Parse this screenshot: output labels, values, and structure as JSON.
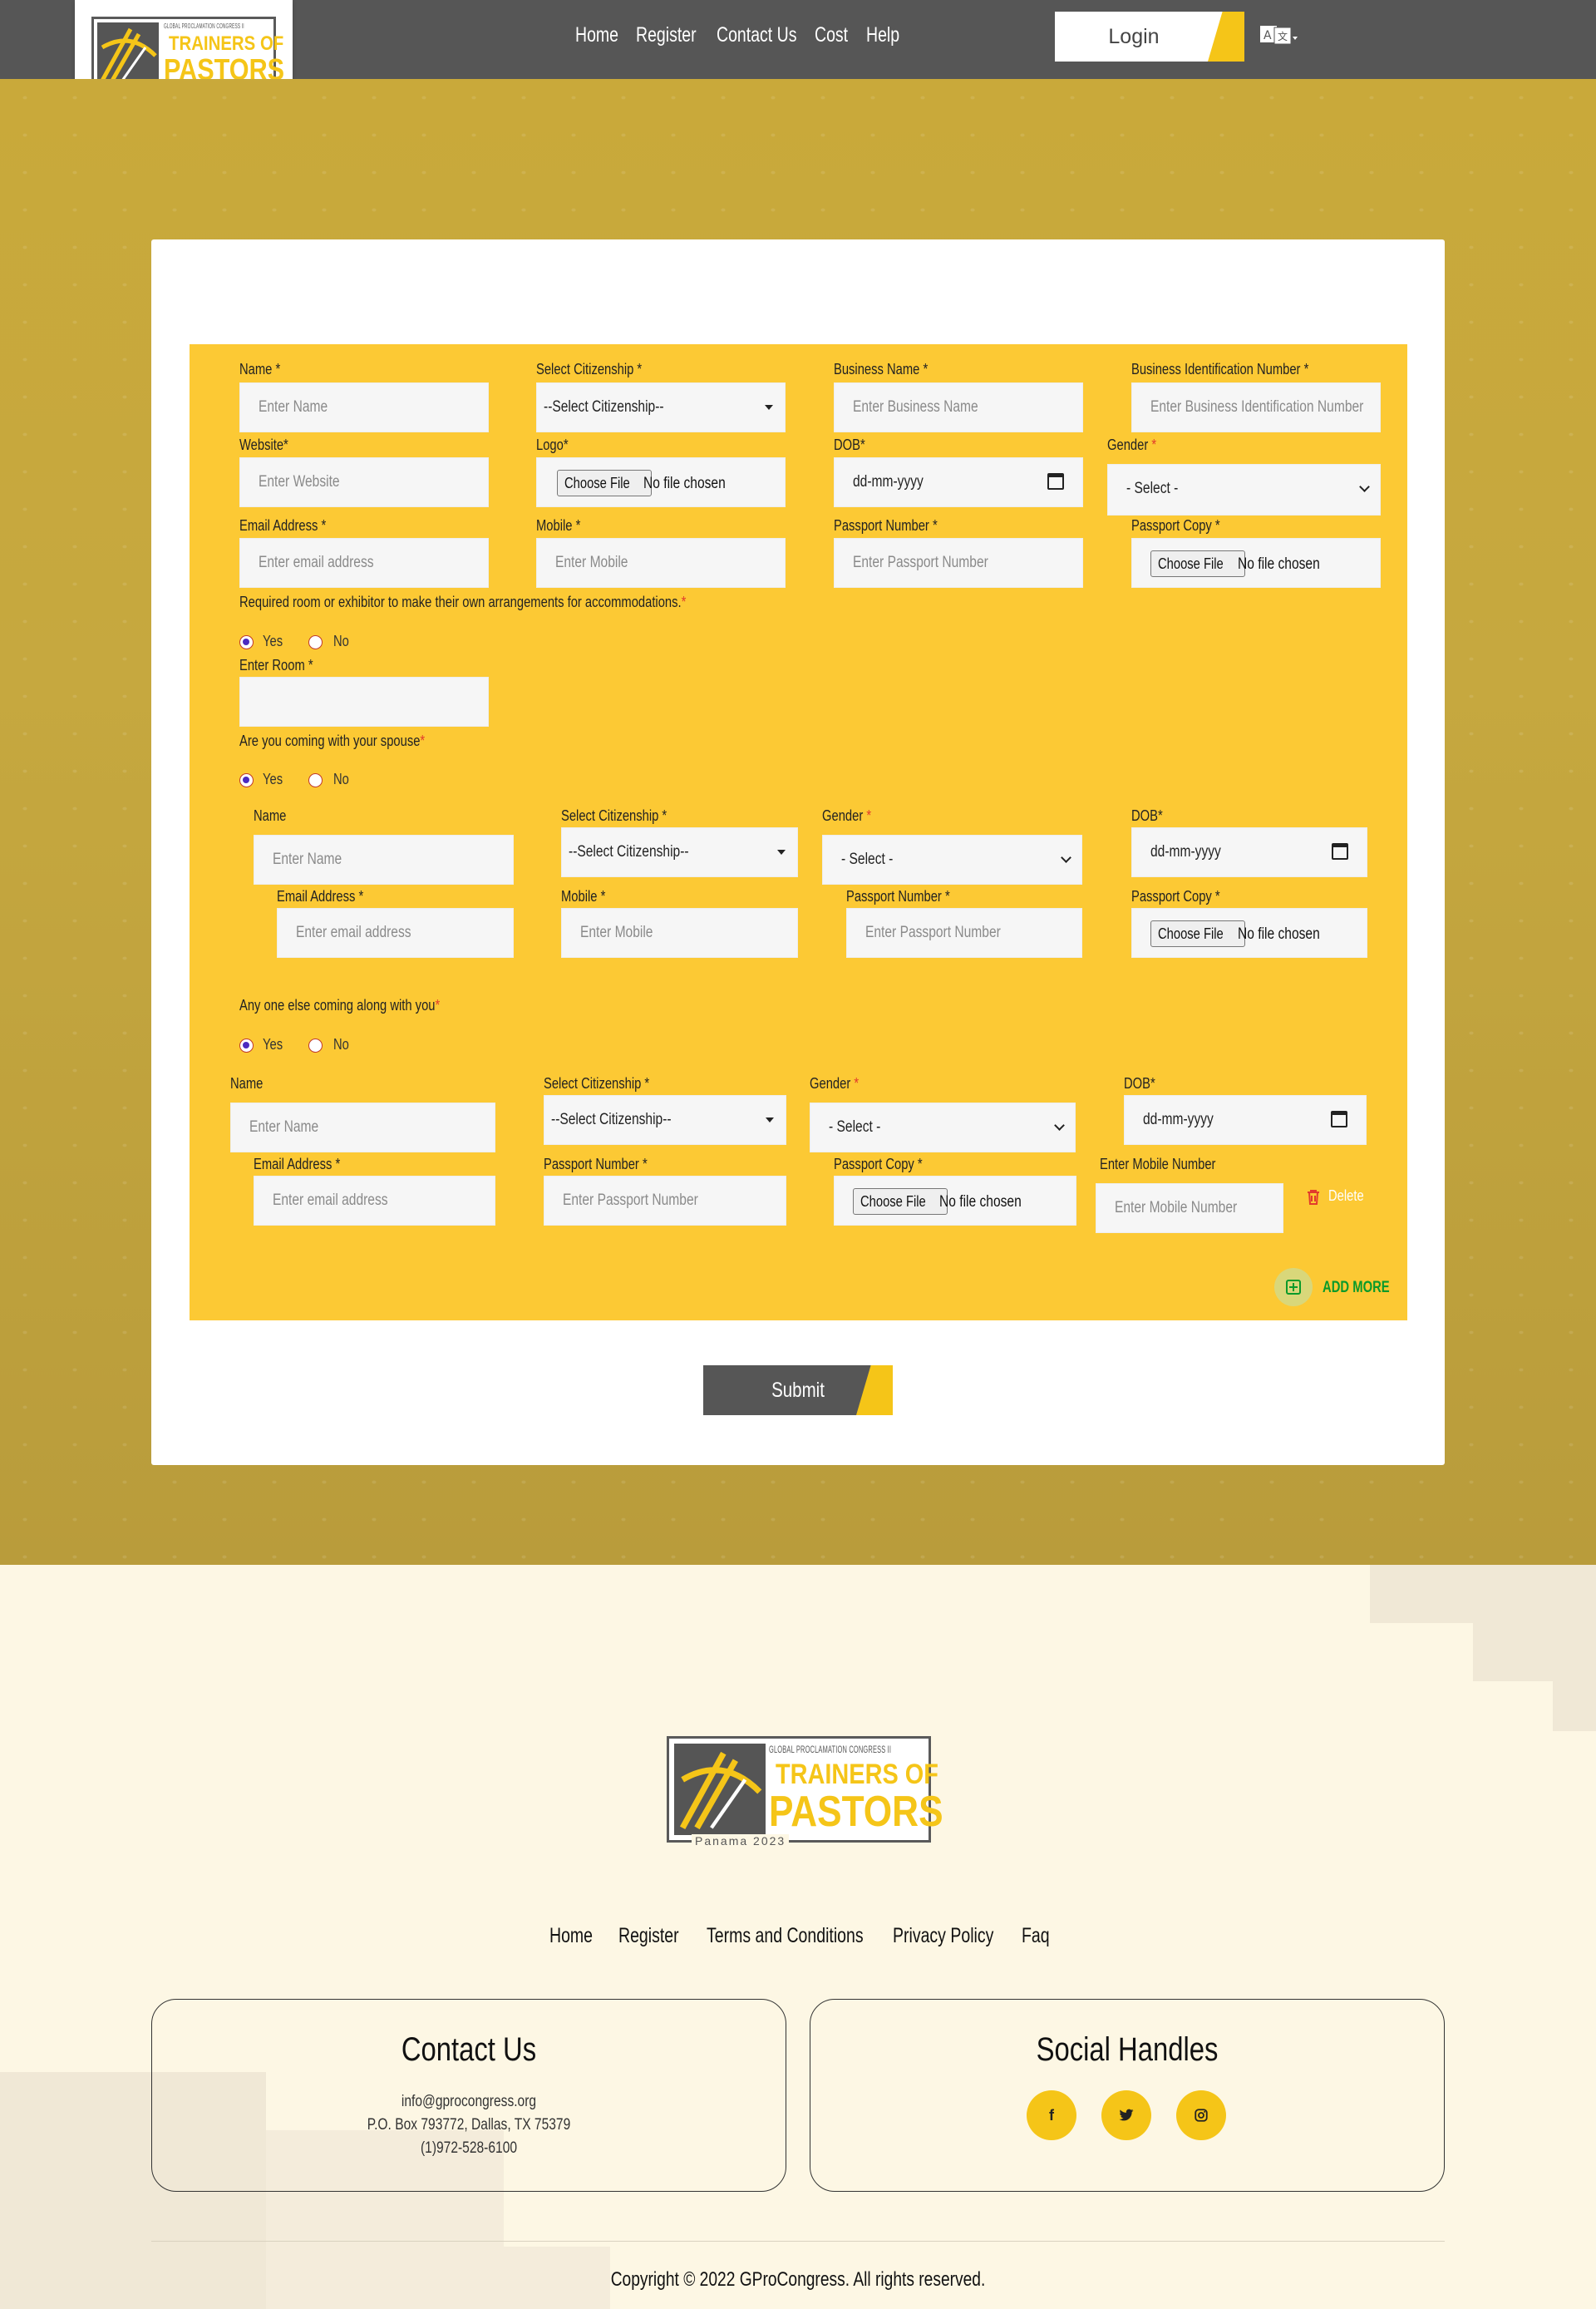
{
  "header": {
    "nav": [
      "Home",
      "Register",
      "Contact Us",
      "Cost",
      "Help"
    ],
    "login_label": "Login",
    "language_icon": "translate-icon"
  },
  "logo": {
    "top_line": "GLOBAL PROCLAMATION CONGRESS II",
    "line1": "TRAINERS OF",
    "line2": "PASTORS",
    "bottom_line": "Panama 2023"
  },
  "form": {
    "business": {
      "name_label": "Name *",
      "name_placeholder": "Enter Name",
      "citizenship_label": "Select Citizenship *",
      "citizenship_value": "--Select Citizenship--",
      "business_name_label": "Business Name *",
      "business_name_placeholder": "Enter Business Name",
      "bin_label": "Business Identification Number *",
      "bin_placeholder": "Enter Business Identification Number",
      "website_label": "Website*",
      "website_placeholder": "Enter Website",
      "logo_label": "Logo*",
      "dob_label": "DOB*",
      "dob_placeholder": "dd-mm-yyyy",
      "gender_label": "Gender ",
      "gender_value": "- Select -",
      "email_label": "Email Address *",
      "email_placeholder": "Enter email address",
      "mobile_label": "Mobile *",
      "mobile_placeholder": "Enter Mobile",
      "passport_label": "Passport Number *",
      "passport_placeholder": "Enter Passport Number",
      "passport_copy_label": "Passport Copy *"
    },
    "file_button": "Choose File",
    "file_none": "No file chosen",
    "room_question": "Required room or exhibitor to make their own arrangements for accommodations.",
    "yes": "Yes",
    "no": "No",
    "room_label": "Enter Room *",
    "spouse_question": "Are you coming with your spouse",
    "spouse": {
      "name_label": "Name",
      "name_placeholder": "Enter Name",
      "citizenship_label": "Select Citizenship *",
      "citizenship_value": "--Select Citizenship--",
      "gender_label": "Gender ",
      "gender_value": "- Select -",
      "dob_label": "DOB*",
      "dob_placeholder": "dd-mm-yyyy",
      "email_label": "Email Address *",
      "email_placeholder": "Enter email address",
      "mobile_label": "Mobile *",
      "mobile_placeholder": "Enter Mobile",
      "passport_label": "Passport Number *",
      "passport_placeholder": "Enter Passport Number",
      "passport_copy_label": "Passport Copy *"
    },
    "companion_question": "Any one else coming along with you",
    "companion": {
      "name_label": "Name",
      "name_placeholder": "Enter Name",
      "citizenship_label": "Select Citizenship *",
      "citizenship_value": "--Select Citizenship--",
      "gender_label": "Gender ",
      "gender_value": "- Select -",
      "dob_label": "DOB*",
      "dob_placeholder": "dd-mm-yyyy",
      "email_label": "Email Address *",
      "email_placeholder": "Enter email address",
      "passport_label": "Passport Number *",
      "passport_placeholder": "Enter Passport Number",
      "passport_copy_label": "Passport Copy *",
      "mobile_label": "Enter Mobile Number",
      "mobile_placeholder": "Enter Mobile Number"
    },
    "delete_label": "Delete",
    "add_more_label": "ADD MORE",
    "submit_label": "Submit"
  },
  "footer": {
    "nav": [
      "Home",
      "Register",
      "Terms and Conditions",
      "Privacy Policy",
      "Faq"
    ],
    "contact_title": "Contact Us",
    "contact_email": "info@gprocongress.org",
    "contact_address": "P.O. Box 793772, Dallas, TX 75379",
    "contact_phone": "(1)972-528-6100",
    "social_title": "Social Handles",
    "social_icons": [
      "facebook-icon",
      "twitter-icon",
      "instagram-icon"
    ],
    "copyright": "Copyright © 2022 GProCongress. All rights reserved."
  },
  "colors": {
    "accent": "#f5c518",
    "form_panel": "#fcc934",
    "header_bg": "#565656",
    "footer_bg": "#fdf7e4",
    "required": "#e23b2c",
    "add_more": "#0a9a2a"
  }
}
